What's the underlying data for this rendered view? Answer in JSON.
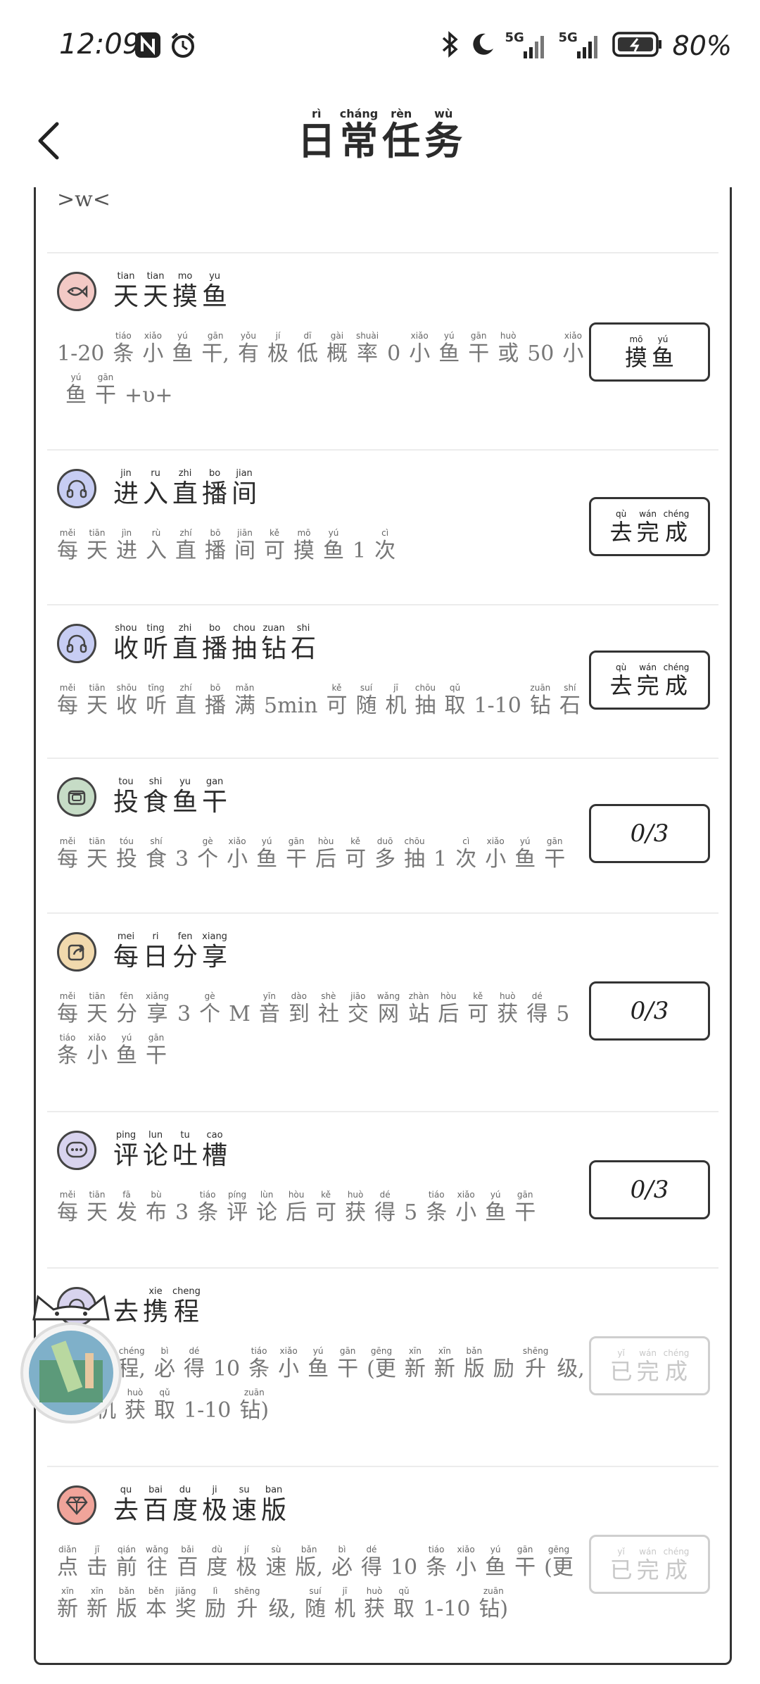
{
  "status_bar": {
    "time": "12:09",
    "battery": "80%",
    "net1": "5G",
    "net2": "5G"
  },
  "header": {
    "title": [
      {
        "c": "日",
        "p": "rì"
      },
      {
        "c": "常",
        "p": "cháng"
      },
      {
        "c": "任",
        "p": "rèn"
      },
      {
        "c": "务",
        "p": "wù"
      }
    ]
  },
  "top_remnant": ">w<",
  "tasks": [
    {
      "icon": "fish-icon",
      "name": [
        {
          "c": "天",
          "p": "tian"
        },
        {
          "c": "天",
          "p": "tian"
        },
        {
          "c": "摸",
          "p": "mo"
        },
        {
          "c": "鱼",
          "p": "yu"
        }
      ],
      "desc": [
        {
          "c": "1-20",
          "p": ""
        },
        {
          "c": "条",
          "p": "tiáo"
        },
        {
          "c": "小",
          "p": "xiǎo"
        },
        {
          "c": "鱼",
          "p": "yú"
        },
        {
          "c": "干,",
          "p": "gān"
        },
        {
          "c": "有",
          "p": "yǒu"
        },
        {
          "c": "极",
          "p": "jí"
        },
        {
          "c": "低",
          "p": "dī"
        },
        {
          "c": "概",
          "p": "gài"
        },
        {
          "c": "率",
          "p": "shuài"
        },
        {
          "c": "0",
          "p": ""
        },
        {
          "c": "小",
          "p": "xiǎo"
        },
        {
          "c": "鱼",
          "p": "yú"
        },
        {
          "c": "干",
          "p": "gān"
        },
        {
          "c": "或",
          "p": "huò"
        },
        {
          "c": "50",
          "p": ""
        },
        {
          "c": "小",
          "p": "xiǎo"
        },
        {
          "c": "鱼",
          "p": "yú"
        },
        {
          "c": "干",
          "p": "gān"
        },
        {
          "c": "+υ+",
          "p": ""
        }
      ],
      "button": {
        "type": "action",
        "chars": [
          {
            "c": "摸",
            "p": "mō"
          },
          {
            "c": "鱼",
            "p": "yú"
          }
        ]
      }
    },
    {
      "icon": "headphones-icon",
      "name": [
        {
          "c": "进",
          "p": "jin"
        },
        {
          "c": "入",
          "p": "ru"
        },
        {
          "c": "直",
          "p": "zhi"
        },
        {
          "c": "播",
          "p": "bo"
        },
        {
          "c": "间",
          "p": "jian"
        }
      ],
      "desc": [
        {
          "c": "每",
          "p": "měi"
        },
        {
          "c": "天",
          "p": "tiān"
        },
        {
          "c": "进",
          "p": "jìn"
        },
        {
          "c": "入",
          "p": "rù"
        },
        {
          "c": "直",
          "p": "zhí"
        },
        {
          "c": "播",
          "p": "bō"
        },
        {
          "c": "间",
          "p": "jiān"
        },
        {
          "c": "可",
          "p": "kě"
        },
        {
          "c": "摸",
          "p": "mō"
        },
        {
          "c": "鱼",
          "p": "yú"
        },
        {
          "c": "1",
          "p": ""
        },
        {
          "c": "次",
          "p": "cì"
        }
      ],
      "button": {
        "type": "action",
        "chars": [
          {
            "c": "去",
            "p": "qù"
          },
          {
            "c": "完",
            "p": "wán"
          },
          {
            "c": "成",
            "p": "chéng"
          }
        ]
      }
    },
    {
      "icon": "headphones-icon",
      "name": [
        {
          "c": "收",
          "p": "shou"
        },
        {
          "c": "听",
          "p": "ting"
        },
        {
          "c": "直",
          "p": "zhi"
        },
        {
          "c": "播",
          "p": "bo"
        },
        {
          "c": "抽",
          "p": "chou"
        },
        {
          "c": "钻",
          "p": "zuan"
        },
        {
          "c": "石",
          "p": "shi"
        }
      ],
      "desc": [
        {
          "c": "每",
          "p": "měi"
        },
        {
          "c": "天",
          "p": "tiān"
        },
        {
          "c": "收",
          "p": "shōu"
        },
        {
          "c": "听",
          "p": "tīng"
        },
        {
          "c": "直",
          "p": "zhí"
        },
        {
          "c": "播",
          "p": "bō"
        },
        {
          "c": "满",
          "p": "mǎn"
        },
        {
          "c": "5min",
          "p": ""
        },
        {
          "c": "可",
          "p": "kě"
        },
        {
          "c": "随",
          "p": "suí"
        },
        {
          "c": "机",
          "p": "jī"
        },
        {
          "c": "抽",
          "p": "chōu"
        },
        {
          "c": "取",
          "p": "qǔ"
        },
        {
          "c": "1-10",
          "p": ""
        },
        {
          "c": "钻",
          "p": "zuān"
        },
        {
          "c": "石",
          "p": "shí"
        }
      ],
      "button": {
        "type": "action",
        "chars": [
          {
            "c": "去",
            "p": "qù"
          },
          {
            "c": "完",
            "p": "wán"
          },
          {
            "c": "成",
            "p": "chéng"
          }
        ]
      }
    },
    {
      "icon": "fish-can-icon",
      "name": [
        {
          "c": "投",
          "p": "tou"
        },
        {
          "c": "食",
          "p": "shi"
        },
        {
          "c": "鱼",
          "p": "yu"
        },
        {
          "c": "干",
          "p": "gan"
        }
      ],
      "desc": [
        {
          "c": "每",
          "p": "měi"
        },
        {
          "c": "天",
          "p": "tiān"
        },
        {
          "c": "投",
          "p": "tóu"
        },
        {
          "c": "食",
          "p": "shí"
        },
        {
          "c": "3",
          "p": ""
        },
        {
          "c": "个",
          "p": "gè"
        },
        {
          "c": "小",
          "p": "xiǎo"
        },
        {
          "c": "鱼",
          "p": "yú"
        },
        {
          "c": "干",
          "p": "gān"
        },
        {
          "c": "后",
          "p": "hòu"
        },
        {
          "c": "可",
          "p": "kě"
        },
        {
          "c": "多",
          "p": "duō"
        },
        {
          "c": "抽",
          "p": "chōu"
        },
        {
          "c": "1",
          "p": ""
        },
        {
          "c": "次",
          "p": "cì"
        },
        {
          "c": "小",
          "p": "xiǎo"
        },
        {
          "c": "鱼",
          "p": "yú"
        },
        {
          "c": "干",
          "p": "gān"
        }
      ],
      "button": {
        "type": "count",
        "text": "0/3"
      }
    },
    {
      "icon": "share-icon",
      "name": [
        {
          "c": "每",
          "p": "mei"
        },
        {
          "c": "日",
          "p": "ri"
        },
        {
          "c": "分",
          "p": "fen"
        },
        {
          "c": "享",
          "p": "xiang"
        }
      ],
      "desc": [
        {
          "c": "每",
          "p": "měi"
        },
        {
          "c": "天",
          "p": "tiān"
        },
        {
          "c": "分",
          "p": "fēn"
        },
        {
          "c": "享",
          "p": "xiǎng"
        },
        {
          "c": "3",
          "p": ""
        },
        {
          "c": "个",
          "p": "gè"
        },
        {
          "c": "M",
          "p": ""
        },
        {
          "c": "音",
          "p": "yīn"
        },
        {
          "c": "到",
          "p": "dào"
        },
        {
          "c": "社",
          "p": "shè"
        },
        {
          "c": "交",
          "p": "jiāo"
        },
        {
          "c": "网",
          "p": "wǎng"
        },
        {
          "c": "站",
          "p": "zhàn"
        },
        {
          "c": "后",
          "p": "hòu"
        },
        {
          "c": "可",
          "p": "kě"
        },
        {
          "c": "获",
          "p": "huò"
        },
        {
          "c": "得",
          "p": "dé"
        },
        {
          "c": "5",
          "p": ""
        },
        {
          "c": "条",
          "p": "tiáo"
        },
        {
          "c": "小",
          "p": "xiǎo"
        },
        {
          "c": "鱼",
          "p": "yú"
        },
        {
          "c": "干",
          "p": "gān"
        }
      ],
      "button": {
        "type": "count",
        "text": "0/3"
      }
    },
    {
      "icon": "chat-bubble-icon",
      "name": [
        {
          "c": "评",
          "p": "ping"
        },
        {
          "c": "论",
          "p": "lun"
        },
        {
          "c": "吐",
          "p": "tu"
        },
        {
          "c": "槽",
          "p": "cao"
        }
      ],
      "desc": [
        {
          "c": "每",
          "p": "měi"
        },
        {
          "c": "天",
          "p": "tiān"
        },
        {
          "c": "发",
          "p": "fā"
        },
        {
          "c": "布",
          "p": "bù"
        },
        {
          "c": "3",
          "p": ""
        },
        {
          "c": "条",
          "p": "tiáo"
        },
        {
          "c": "评",
          "p": "píng"
        },
        {
          "c": "论",
          "p": "lùn"
        },
        {
          "c": "后",
          "p": "hòu"
        },
        {
          "c": "可",
          "p": "kě"
        },
        {
          "c": "获",
          "p": "huò"
        },
        {
          "c": "得",
          "p": "dé"
        },
        {
          "c": "5",
          "p": ""
        },
        {
          "c": "条",
          "p": "tiáo"
        },
        {
          "c": "小",
          "p": "xiǎo"
        },
        {
          "c": "鱼",
          "p": "yú"
        },
        {
          "c": "干",
          "p": "gān"
        }
      ],
      "button": {
        "type": "count",
        "text": "0/3"
      }
    },
    {
      "icon": "travel-icon",
      "name": [
        {
          "c": "去",
          "p": ""
        },
        {
          "c": "携",
          "p": "xie"
        },
        {
          "c": "程",
          "p": "cheng"
        }
      ],
      "desc": [
        {
          "c": "往",
          "p": "wǎng"
        },
        {
          "c": "携",
          "p": "xié"
        },
        {
          "c": "程,",
          "p": "chéng"
        },
        {
          "c": "必",
          "p": "bì"
        },
        {
          "c": "得",
          "p": "dé"
        },
        {
          "c": "10",
          "p": ""
        },
        {
          "c": "条",
          "p": "tiáo"
        },
        {
          "c": "小",
          "p": "xiǎo"
        },
        {
          "c": "鱼",
          "p": "yú"
        },
        {
          "c": "干",
          "p": "gān"
        },
        {
          "c": "(更",
          "p": "gēng"
        },
        {
          "c": "新",
          "p": "xīn"
        },
        {
          "c": "新",
          "p": "xīn"
        },
        {
          "c": "版",
          "p": "bǎn"
        },
        {
          "c": "励",
          "p": ""
        },
        {
          "c": "升",
          "p": "shēng"
        },
        {
          "c": "级,",
          "p": ""
        },
        {
          "c": "随",
          "p": "suí"
        },
        {
          "c": "机",
          "p": "jī"
        },
        {
          "c": "获",
          "p": "huò"
        },
        {
          "c": "取",
          "p": "qǔ"
        },
        {
          "c": "1-10",
          "p": ""
        },
        {
          "c": "钻)",
          "p": "zuān"
        }
      ],
      "button": {
        "type": "done",
        "chars": [
          {
            "c": "已",
            "p": "yǐ"
          },
          {
            "c": "完",
            "p": "wán"
          },
          {
            "c": "成",
            "p": "chéng"
          }
        ]
      }
    },
    {
      "icon": "diamond-icon",
      "name": [
        {
          "c": "去",
          "p": "qu"
        },
        {
          "c": "百",
          "p": "bai"
        },
        {
          "c": "度",
          "p": "du"
        },
        {
          "c": "极",
          "p": "ji"
        },
        {
          "c": "速",
          "p": "su"
        },
        {
          "c": "版",
          "p": "ban"
        }
      ],
      "desc": [
        {
          "c": "点",
          "p": "diǎn"
        },
        {
          "c": "击",
          "p": "jī"
        },
        {
          "c": "前",
          "p": "qián"
        },
        {
          "c": "往",
          "p": "wǎng"
        },
        {
          "c": "百",
          "p": "bǎi"
        },
        {
          "c": "度",
          "p": "dù"
        },
        {
          "c": "极",
          "p": "jí"
        },
        {
          "c": "速",
          "p": "sù"
        },
        {
          "c": "版,",
          "p": "bǎn"
        },
        {
          "c": "必",
          "p": "bì"
        },
        {
          "c": "得",
          "p": "dé"
        },
        {
          "c": "10",
          "p": ""
        },
        {
          "c": "条",
          "p": "tiáo"
        },
        {
          "c": "小",
          "p": "xiǎo"
        },
        {
          "c": "鱼",
          "p": "yú"
        },
        {
          "c": "干",
          "p": "gān"
        },
        {
          "c": "(更",
          "p": "gēng"
        },
        {
          "c": "新",
          "p": "xīn"
        },
        {
          "c": "新",
          "p": "xīn"
        },
        {
          "c": "版",
          "p": "bǎn"
        },
        {
          "c": "本",
          "p": "běn"
        },
        {
          "c": "奖",
          "p": "jiǎng"
        },
        {
          "c": "励",
          "p": "lì"
        },
        {
          "c": "升",
          "p": "shēng"
        },
        {
          "c": "级,",
          "p": ""
        },
        {
          "c": "随",
          "p": "suí"
        },
        {
          "c": "机",
          "p": "jī"
        },
        {
          "c": "获",
          "p": "huò"
        },
        {
          "c": "取",
          "p": "qǔ"
        },
        {
          "c": "1-10",
          "p": ""
        },
        {
          "c": "钻)",
          "p": "zuān"
        }
      ],
      "button": {
        "type": "done",
        "chars": [
          {
            "c": "已",
            "p": "yǐ"
          },
          {
            "c": "完",
            "p": "wán"
          },
          {
            "c": "成",
            "p": "chéng"
          }
        ]
      }
    }
  ],
  "colors": {
    "fish": "#f3c9c5",
    "headphones": "#c7cdf3",
    "can": "#c6dcc6",
    "share": "#f1d9ad",
    "chat": "#d8d3ee",
    "diamond": "#f0a49a",
    "done_text": "#c8c8c8"
  }
}
